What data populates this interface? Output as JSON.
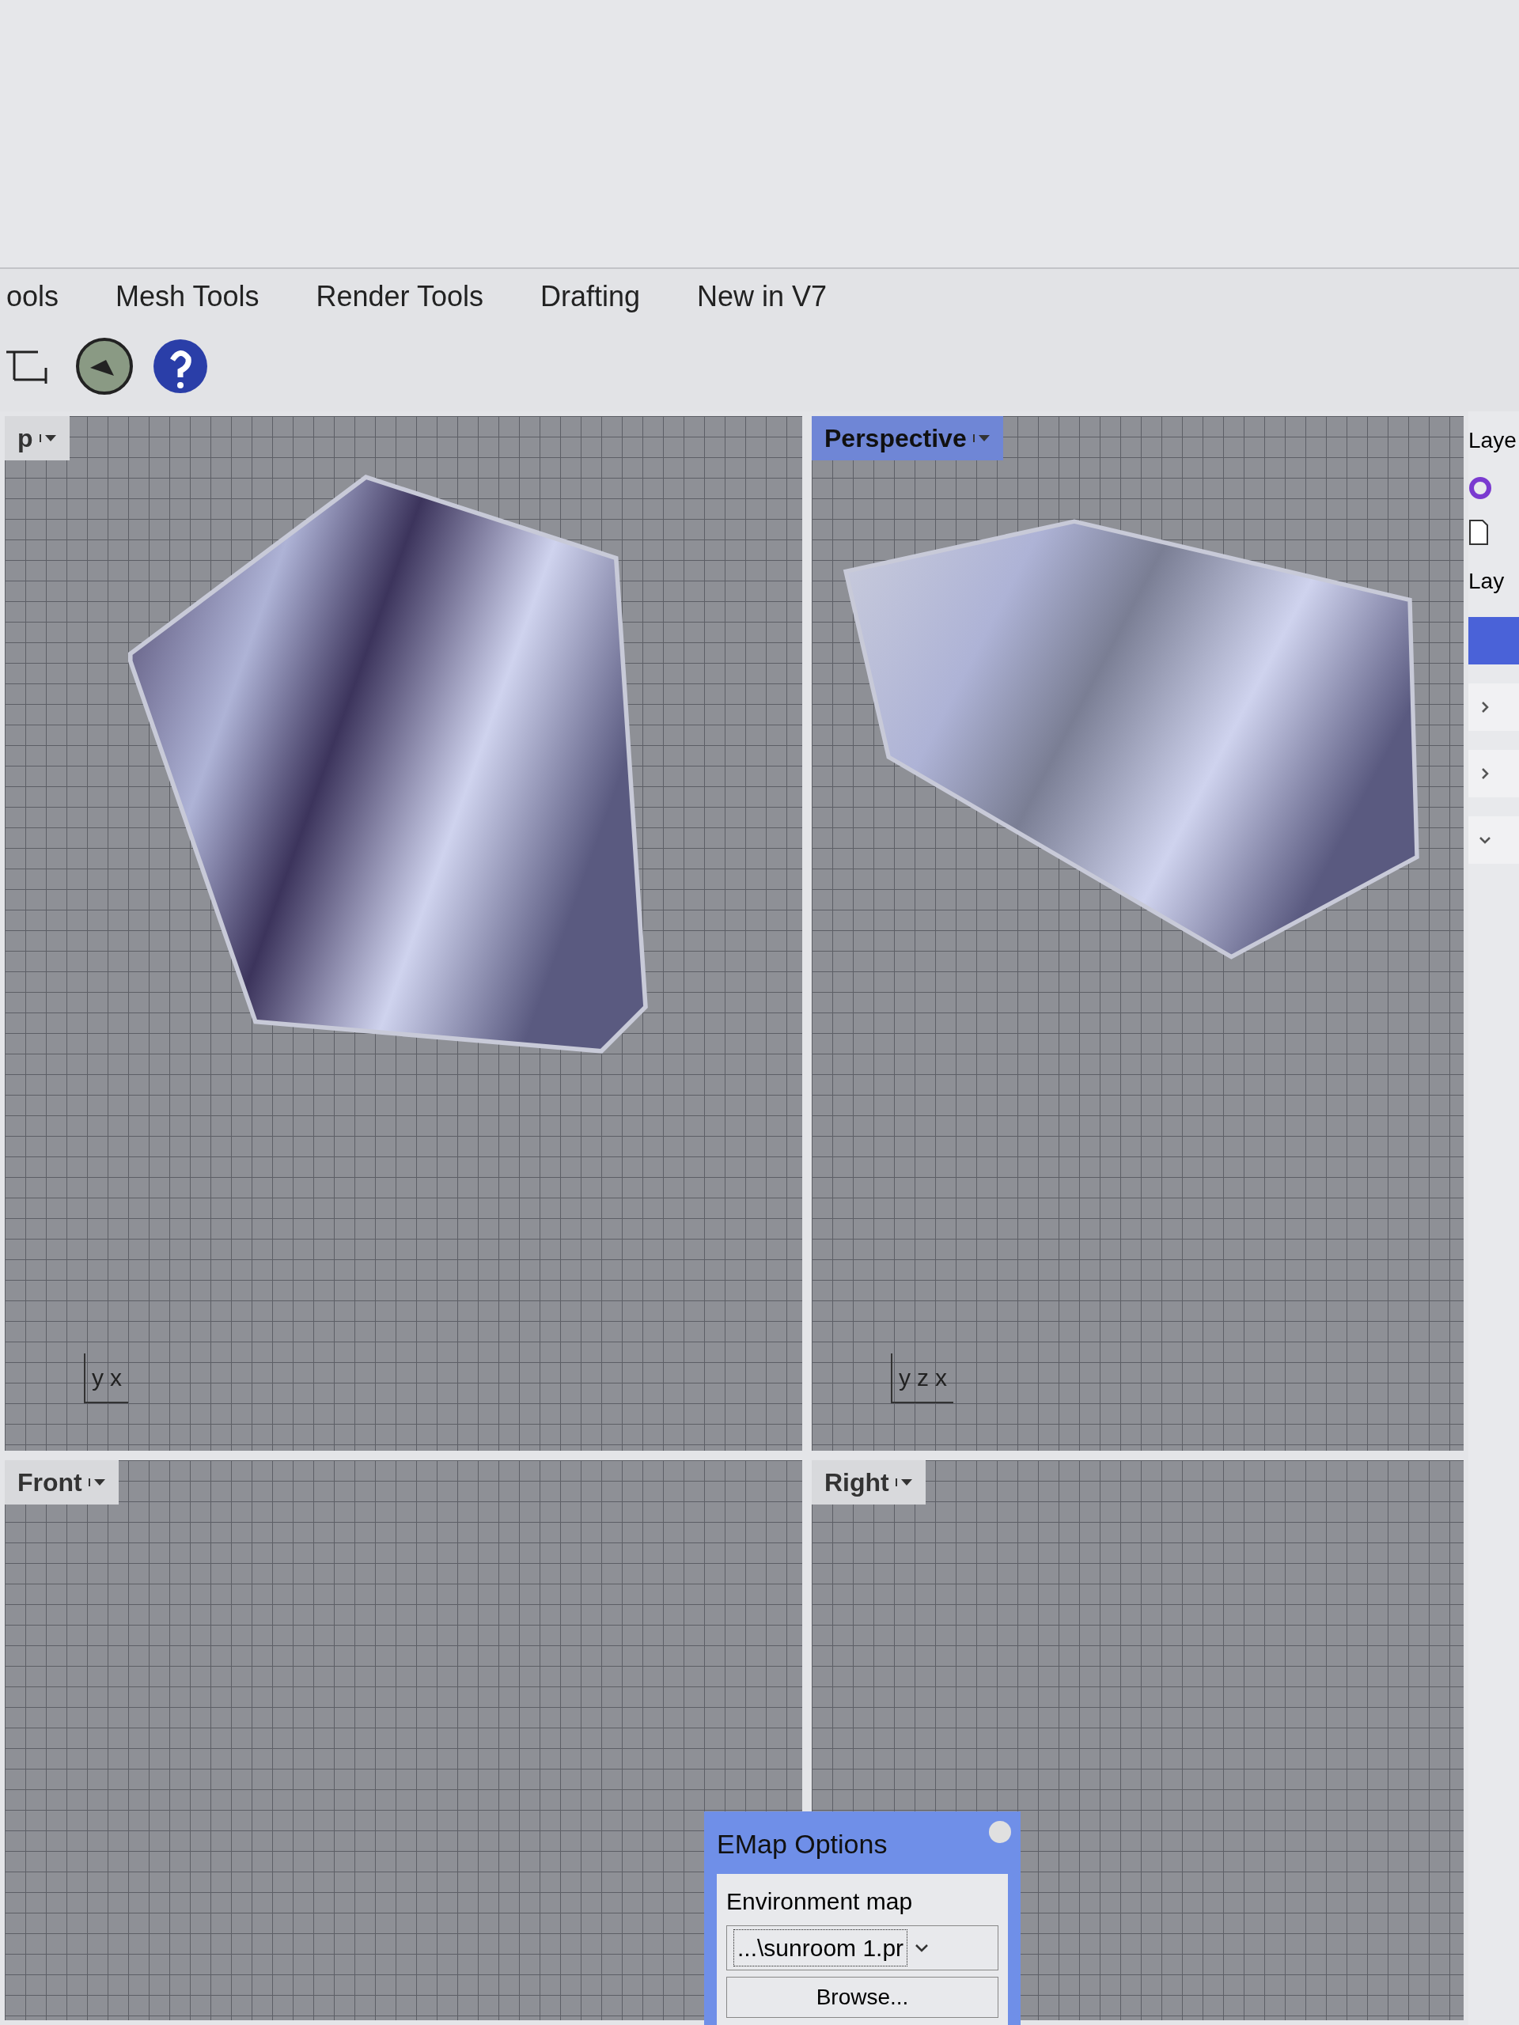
{
  "tabs": [
    {
      "label": "ools",
      "selected": false
    },
    {
      "label": "Mesh Tools",
      "selected": false
    },
    {
      "label": "Render Tools",
      "selected": false
    },
    {
      "label": "Drafting",
      "selected": false
    },
    {
      "label": "New in V7",
      "selected": false
    }
  ],
  "viewports": [
    {
      "title": "p",
      "active": false,
      "axes": [
        "y",
        "x"
      ]
    },
    {
      "title": "Perspective",
      "active": true,
      "axes": [
        "y",
        "z",
        "x"
      ]
    },
    {
      "title": "Front",
      "active": false
    },
    {
      "title": "Right",
      "active": false
    }
  ],
  "layers_panel": {
    "title": "Laye",
    "header": "Lay",
    "rows": [
      {
        "kind": "highlight",
        "selected": true
      },
      {
        "kind": "group",
        "selected": false,
        "expanded": false
      },
      {
        "kind": "group",
        "selected": false,
        "expanded": false
      },
      {
        "kind": "group",
        "selected": false,
        "expanded": true
      }
    ]
  },
  "dialog": {
    "title": "EMap Options",
    "label": "Environment map",
    "value": "...\\sunroom 1.pr",
    "button": "Browse..."
  }
}
